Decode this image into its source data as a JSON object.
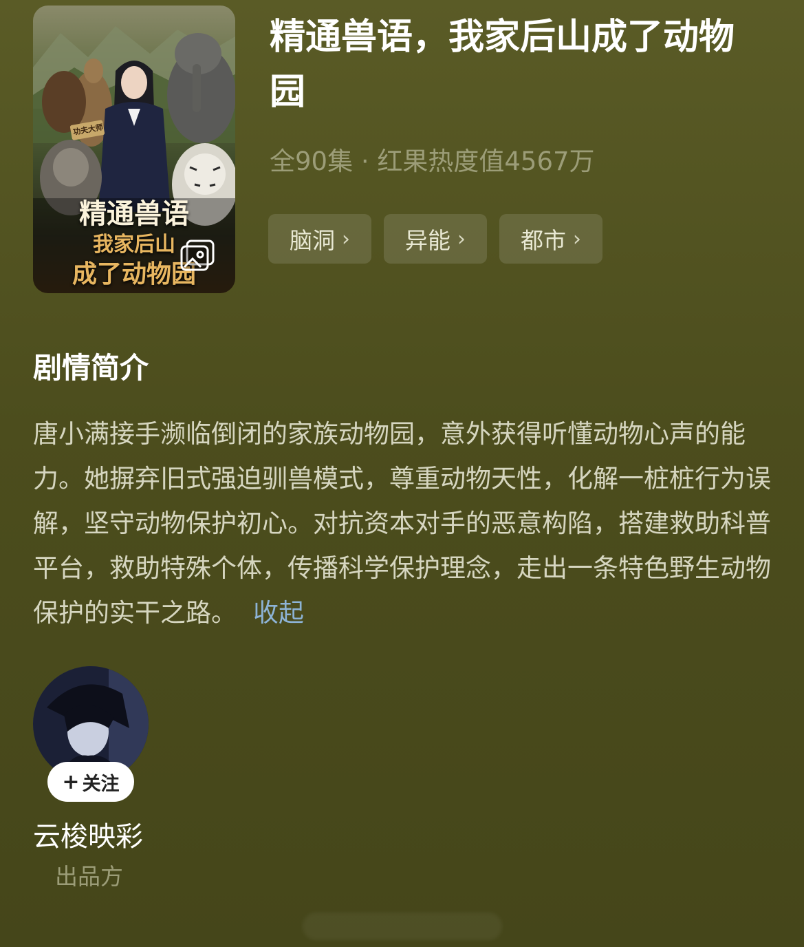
{
  "drama": {
    "title": "精通兽语，我家后山成了动物园",
    "meta": "全90集 · 红果热度值4567万",
    "tags": [
      "脑洞",
      "异能",
      "都市"
    ],
    "poster": {
      "line1": "精通兽语",
      "line2": "我家后山",
      "line3": "成了动物园",
      "sign": "功夫大师"
    }
  },
  "synopsis": {
    "heading": "剧情简介",
    "text": "唐小满接手濒临倒闭的家族动物园，意外获得听懂动物心声的能力。她摒弃旧式强迫驯兽模式，尊重动物天性，化解一桩桩行为误解，坚守动物保护初心。对抗资本对手的恶意构陷，搭建救助科普平台，救助特殊个体，传播科学保护理念，走出一条特色野生动物保护的实干之路。",
    "collapse_label": "收起"
  },
  "producer": {
    "follow_label": "关注",
    "name": "云梭映彩",
    "role": "出品方"
  },
  "icons": {
    "gallery": "gallery-icon",
    "chevron": "chevron-right-icon",
    "plus": "plus-icon"
  },
  "colors": {
    "background": "#4c4d1d",
    "muted_text": "#9c9d78",
    "link": "#8db3d6"
  }
}
